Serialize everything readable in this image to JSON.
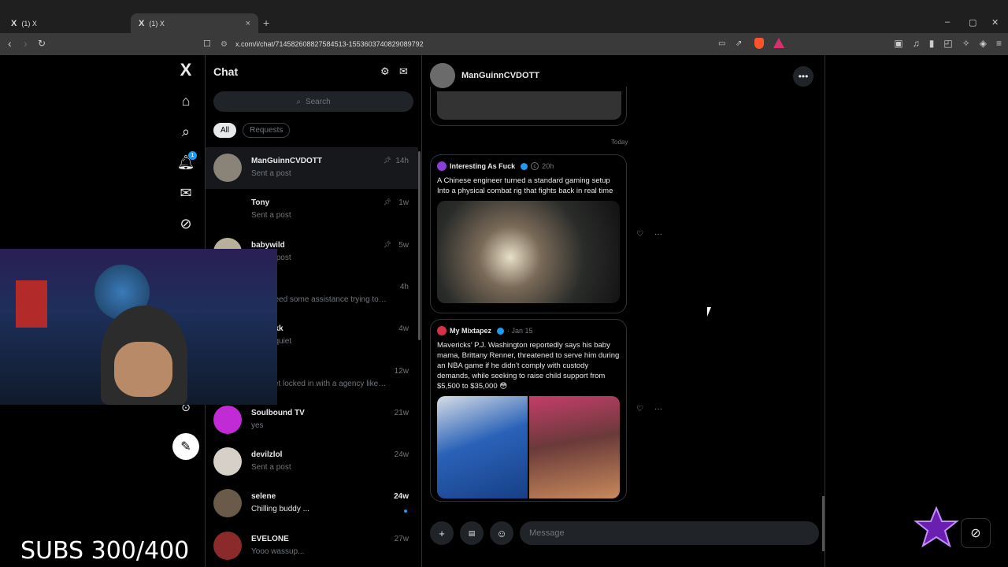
{
  "browser": {
    "tabs": [
      {
        "icon": "X",
        "label": "(1) X",
        "active": false
      },
      {
        "icon": "X",
        "label": "(1) X",
        "active": true,
        "close": "×"
      }
    ],
    "new_tab": "+",
    "url": "x.com/i/chat/714582608827584513-1553603740829089792",
    "window_controls": [
      "–",
      "▢",
      "✕"
    ]
  },
  "leftnav": {
    "logo": "X",
    "notif_count": "1",
    "items": [
      "home-icon",
      "search-icon",
      "bell-icon",
      "mail-icon",
      "grok-icon"
    ]
  },
  "chat": {
    "title": "Chat",
    "search_placeholder": "Search",
    "filters": [
      "All",
      "Requests"
    ],
    "conversations": [
      {
        "name": "ManGuinnCVDOTT",
        "preview": "Sent a post",
        "time": "14h",
        "pinned": true,
        "avatar_color": "#8a8478"
      },
      {
        "name": "Tony",
        "preview": "Sent a post",
        "time": "1w",
        "pinned": true,
        "avatar_color": "#000000"
      },
      {
        "name": "babywild",
        "preview": "Sent a post",
        "time": "5w",
        "pinned": true,
        "avatar_color": "#b9b09a"
      },
      {
        "name": "…ng",
        "preview": "…h I need some assistance trying to…",
        "time": "4h",
        "pinned": false,
        "avatar_color": "#333333"
      },
      {
        "name": "…Clarkk",
        "preview": "…een quiet",
        "time": "4w",
        "pinned": false,
        "avatar_color": "#333333"
      },
      {
        "name": "…g",
        "preview": "…n i get locked in with a agency like…",
        "time": "12w",
        "pinned": false,
        "avatar_color": "#333333"
      },
      {
        "name": "Soulbound TV",
        "preview": "yes",
        "time": "21w",
        "pinned": false,
        "avatar_color": "#c02bd6"
      },
      {
        "name": "devilzlol",
        "preview": "Sent a post",
        "time": "24w",
        "pinned": false,
        "avatar_color": "#d7d0c8"
      },
      {
        "name": "selene",
        "preview": "Chilling buddy ...",
        "time": "24w",
        "pinned": false,
        "unread": true,
        "avatar_color": "#6a5a4a"
      },
      {
        "name": "EVELONE",
        "preview": "Yooo wassup...",
        "time": "27w",
        "pinned": false,
        "avatar_color": "#8a2a2a"
      }
    ]
  },
  "thread": {
    "contact": "ManGuinnCVDOTT",
    "date_divider": "Today",
    "posts": [
      {
        "author": "Interesting As Fuck",
        "badge": "c",
        "time": "20h",
        "text": "A Chinese engineer turned a standard gaming setup Into a physical combat rig that fights back in real time",
        "avatar_color": "#8b3fd9"
      },
      {
        "author": "My Mixtapez",
        "time": "Jan 15",
        "text": "Mavericks’ P.J. Washington reportedly says his baby mama, Brittany Renner, threatened to serve him during an NBA game if he didn’t comply with custody demands, while seeking to raise child support from $5,500 to $35,000 😳",
        "avatar_color": "#d9304a"
      }
    ],
    "message_placeholder": "Message"
  },
  "overlay": {
    "subs": "SUBS 300/400"
  },
  "colors": {
    "accent": "#1d9bf0",
    "background": "#000000",
    "muted": "#71767b"
  }
}
